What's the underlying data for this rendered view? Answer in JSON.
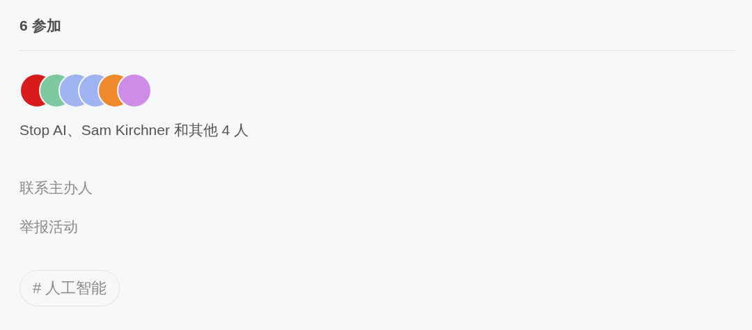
{
  "header": {
    "title": "6 参加"
  },
  "avatars": [
    {
      "color": "#d81b1b"
    },
    {
      "color": "#7cc8a0"
    },
    {
      "color": "#9fb2f2"
    },
    {
      "color": "#9fb2f2"
    },
    {
      "color": "#ef8a2c"
    },
    {
      "color": "#cf8ce6"
    }
  ],
  "attendees_text": "Stop AI、Sam Kirchner 和其他 4 人",
  "links": [
    "联系主办人",
    "举报活动"
  ],
  "tags": [
    {
      "icon": "#",
      "label": "人工智能"
    }
  ]
}
